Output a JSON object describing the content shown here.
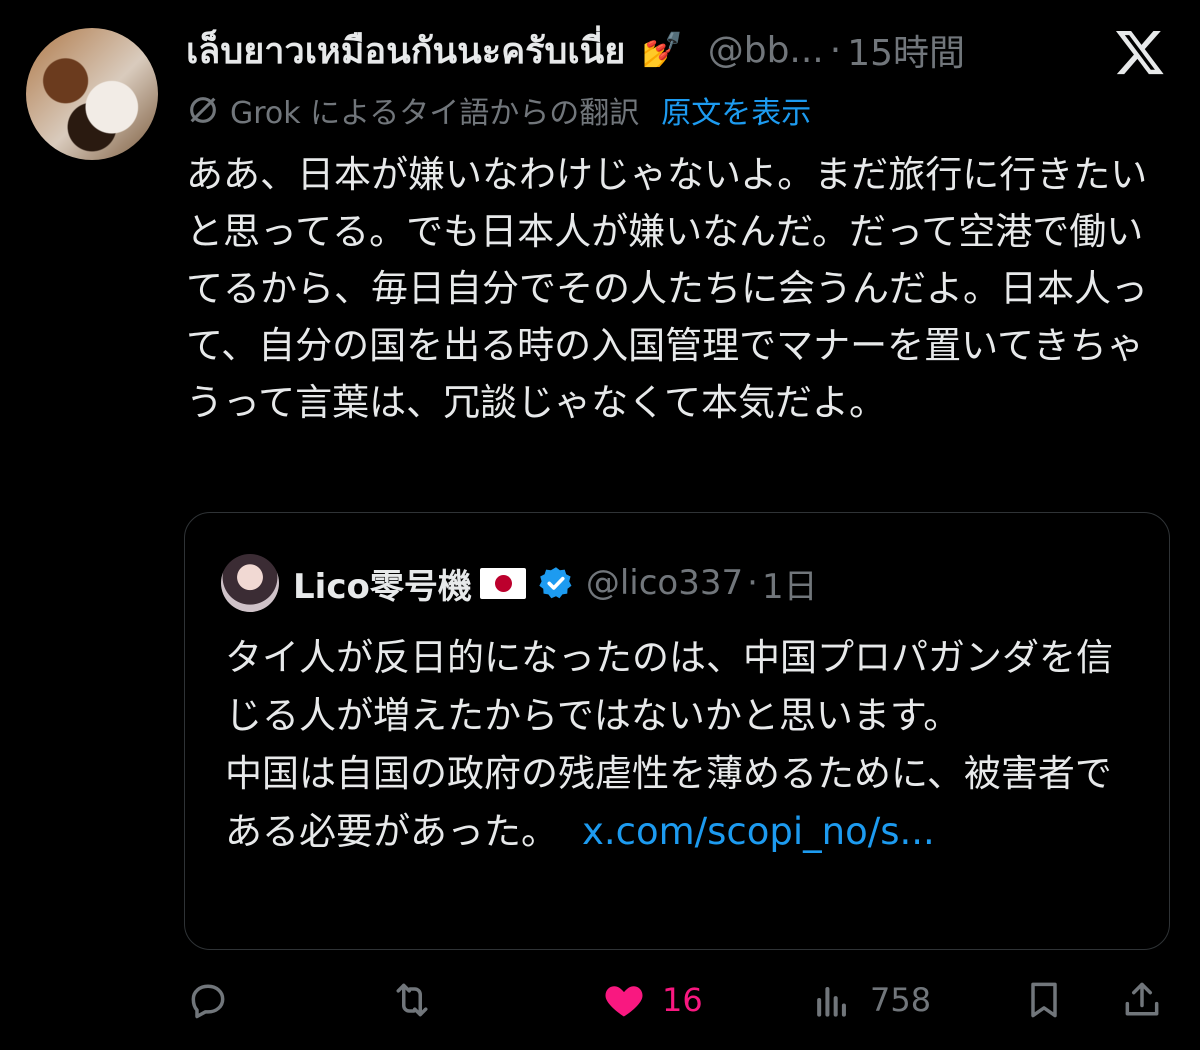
{
  "post": {
    "display_name": "เล็บยาวเหมือนกันนะครับเนี่ย",
    "emoji": "💅",
    "handle": "@bb...",
    "separator": "·",
    "time": "15時間",
    "translation_note": "Grok によるタイ語からの翻訳",
    "show_original": "原文を表示",
    "body": "ああ、日本が嫌いなわけじゃないよ。まだ旅行に行きたいと思ってる。でも日本人が嫌いなんだ。だって空港で働いてるから、毎日自分でその人たちに会うんだよ。日本人って、自分の国を出る時の入国管理でマナーを置いてきちゃうって言葉は、冗談じゃなくて本気だよ。"
  },
  "quote": {
    "name": "Lico零号機",
    "handle": "@lico337",
    "separator": "·",
    "time": "1日",
    "body_line1": "タイ人が反日的になったのは、中国プロパガンダを信じる人が増えたからではないかと思います。",
    "body_line2": "中国は自国の政府の残虐性を薄めるために、被害者である必要があった。",
    "link": "x.com/scopi_no/s..."
  },
  "actions": {
    "likes": "16",
    "views": "758"
  },
  "icons": [
    "x-logo-icon",
    "grok-icon",
    "verified-badge-icon",
    "japan-flag-icon",
    "reply-icon",
    "repost-icon",
    "heart-icon",
    "views-icon",
    "bookmark-icon",
    "share-icon"
  ],
  "colors": {
    "background": "#000000",
    "text": "#e7e9ea",
    "muted": "#71767b",
    "link": "#1d9bf0",
    "like": "#f91880"
  }
}
